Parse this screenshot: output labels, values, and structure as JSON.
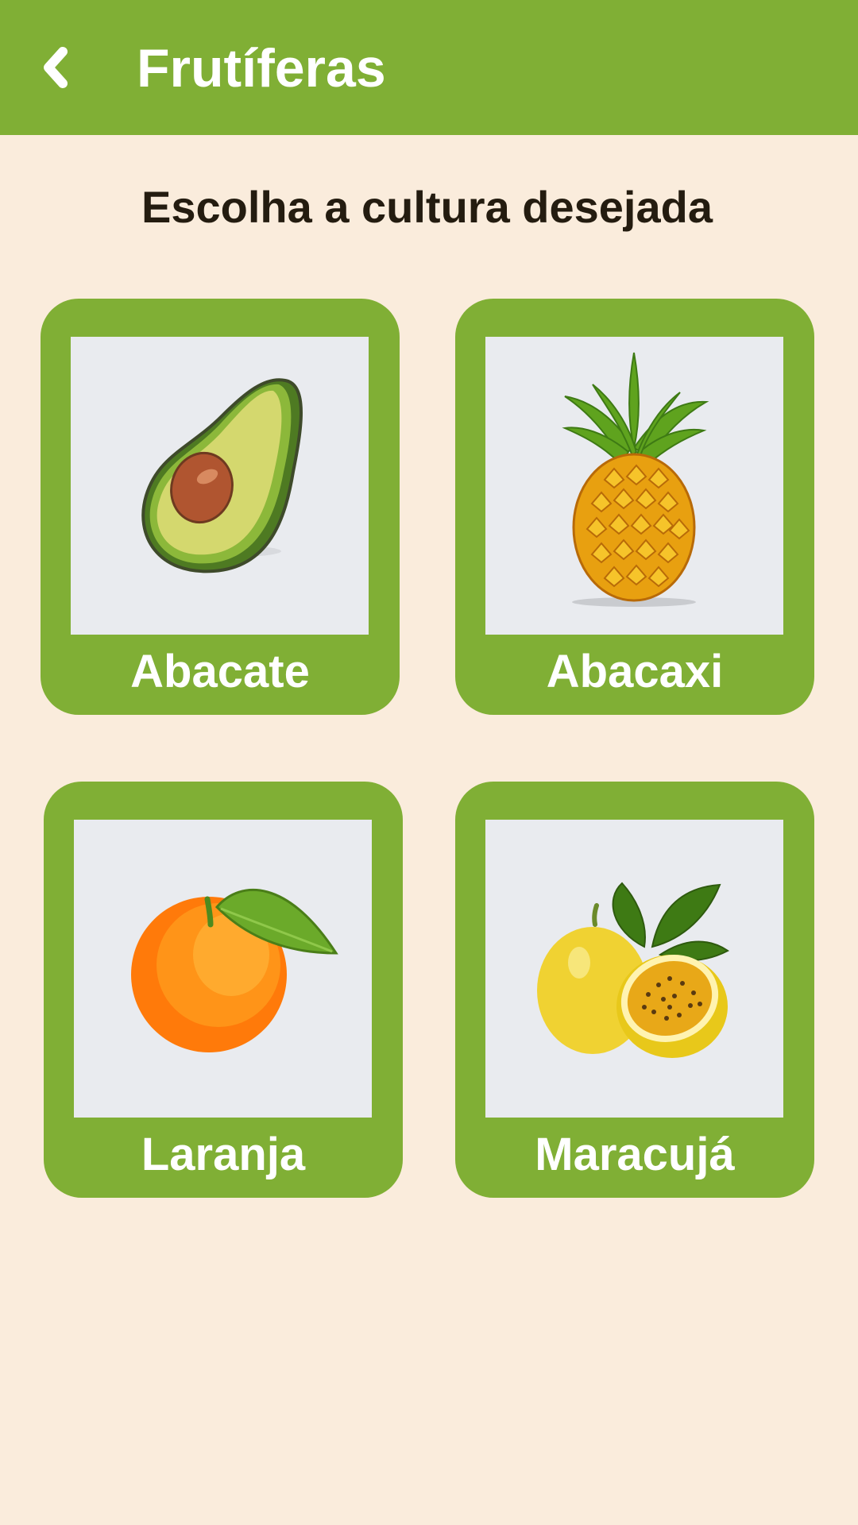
{
  "header": {
    "back_icon": "chevron-left-icon",
    "title": "Frutíferas"
  },
  "main": {
    "prompt": "Escolha a cultura desejada"
  },
  "crops": [
    {
      "label": "Abacate",
      "icon": "avocado-icon"
    },
    {
      "label": "Abacaxi",
      "icon": "pineapple-icon"
    },
    {
      "label": "Laranja",
      "icon": "orange-icon"
    },
    {
      "label": "Maracujá",
      "icon": "passion-fruit-icon"
    }
  ],
  "colors": {
    "app_bar": "#80AF35",
    "background": "#FAECDC",
    "card": "#80AF35",
    "image_bg": "#E9EBEF",
    "prompt_text": "#241C10"
  }
}
